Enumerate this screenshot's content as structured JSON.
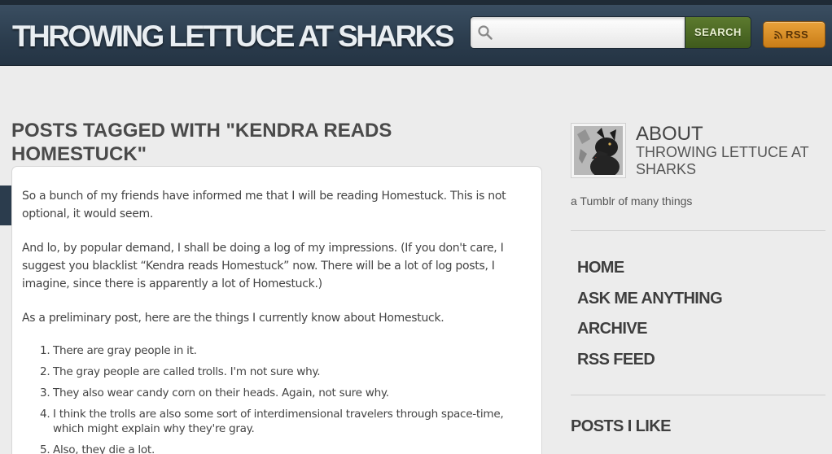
{
  "header": {
    "site_title": "THROWING LETTUCE AT SHARKS",
    "search": {
      "value": "",
      "placeholder": "",
      "button_label": "SEARCH"
    },
    "rss_label": "RSS"
  },
  "main": {
    "heading": "POSTS TAGGED WITH \"KENDRA READS HOMESTUCK\"",
    "post": {
      "paragraphs": [
        "So a bunch of my friends have informed me that I will be reading Homestuck.  This is not optional, it would seem.",
        "And lo, by popular demand, I shall be doing a log of my impressions.  (If you don't care, I suggest you blacklist “Kendra reads Homestuck” now.  There will be a lot of log posts, I imagine, since there is apparently a lot of Homestuck.)",
        "As a preliminary post, here are the things I currently know about Homestuck."
      ],
      "list": [
        {
          "num": "1.",
          "text": "There are gray people in it."
        },
        {
          "num": "2.",
          "text": "The gray people are called trolls.  I'm not sure why."
        },
        {
          "num": "3.",
          "text": "They also wear candy corn on their heads.  Again, not sure why."
        },
        {
          "num": "4.",
          "text": "I think the trolls are also some sort of interdimensional travelers through space-time, which might explain why they're gray."
        },
        {
          "num": "5.",
          "text": "Also, they die a lot."
        }
      ]
    }
  },
  "sidebar": {
    "about_title": "ABOUT",
    "about_subtitle": "THROWING LETTUCE AT SHARKS",
    "description": "a Tumblr of many things",
    "nav": [
      {
        "label": "HOME"
      },
      {
        "label": "ASK ME ANYTHING"
      },
      {
        "label": "ARCHIVE"
      },
      {
        "label": "RSS FEED"
      }
    ],
    "posts_i_like": "POSTS I LIKE"
  },
  "colors": {
    "header_bg": "#2b3c4d",
    "page_bg": "#ececec",
    "search_button": "#4e6b25",
    "rss_button": "#d98c26"
  }
}
